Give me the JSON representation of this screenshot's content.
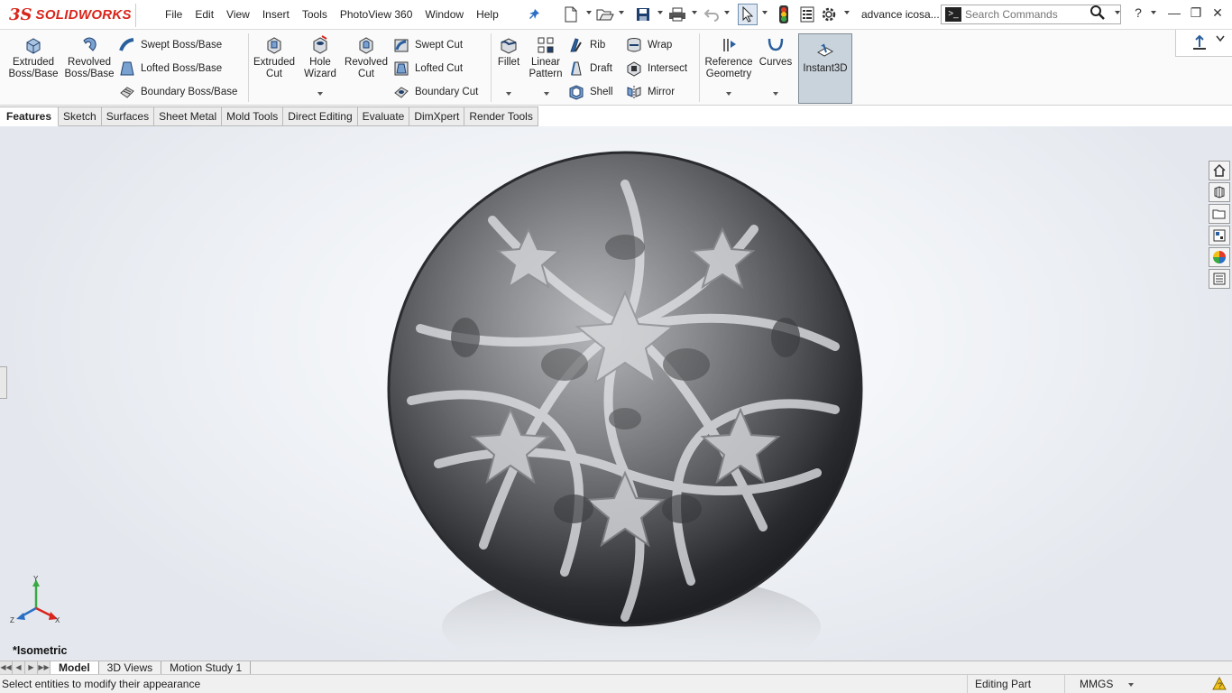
{
  "app": {
    "logo_ds": "3S",
    "logo_text": "SOLIDWORKS",
    "document_title": "advance icosa..."
  },
  "menu": [
    "File",
    "Edit",
    "View",
    "Insert",
    "Tools",
    "PhotoView 360",
    "Window",
    "Help"
  ],
  "search": {
    "placeholder": "Search Commands"
  },
  "toolbar_icons": [
    "pin-icon",
    "new-document-icon",
    "open-icon",
    "save-icon",
    "print-icon",
    "undo-icon",
    "select-icon",
    "rebuild-icon",
    "file-properties-icon",
    "options-icon"
  ],
  "ribbon": {
    "extruded_boss": "Extruded Boss/Base",
    "revolved_boss": "Revolved Boss/Base",
    "swept_boss": "Swept Boss/Base",
    "lofted_boss": "Lofted Boss/Base",
    "boundary_boss": "Boundary Boss/Base",
    "extruded_cut": "Extruded Cut",
    "hole_wizard": "Hole Wizard",
    "revolved_cut": "Revolved Cut",
    "swept_cut": "Swept Cut",
    "lofted_cut": "Lofted Cut",
    "boundary_cut": "Boundary Cut",
    "fillet": "Fillet",
    "linear_pattern": "Linear Pattern",
    "rib": "Rib",
    "draft": "Draft",
    "shell": "Shell",
    "wrap": "Wrap",
    "intersect": "Intersect",
    "mirror": "Mirror",
    "reference_geometry": "Reference Geometry",
    "curves": "Curves",
    "instant3d": "Instant3D"
  },
  "tabs": [
    "Features",
    "Sketch",
    "Surfaces",
    "Sheet Metal",
    "Mold Tools",
    "Direct Editing",
    "Evaluate",
    "DimXpert",
    "Render Tools"
  ],
  "active_tab": "Features",
  "viewport": {
    "view_orientation": "*Isometric",
    "triad_axes": [
      "Y",
      "Z",
      "X"
    ]
  },
  "task_pane": [
    "home-icon",
    "design-library-icon",
    "file-explorer-icon",
    "view-palette-icon",
    "appearances-icon",
    "custom-properties-icon"
  ],
  "bottom_tabs": [
    "Model",
    "3D Views",
    "Motion Study 1"
  ],
  "active_bottom_tab": "Model",
  "status": {
    "message": "Select entities to modify their appearance",
    "mode": "Editing Part",
    "units": "MMGS"
  },
  "colors": {
    "brand": "#d9251c",
    "instant3d_active": "#c9d3dc"
  }
}
